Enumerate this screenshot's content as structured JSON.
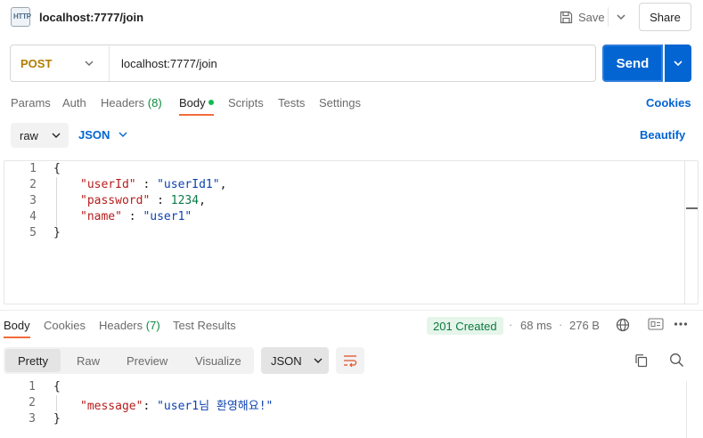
{
  "header": {
    "title": "localhost:7777/join",
    "app_icon_text": "HTTP",
    "save_label": "Save",
    "share_label": "Share"
  },
  "request": {
    "method": "POST",
    "url": "localhost:7777/join",
    "send_label": "Send"
  },
  "request_tabs": [
    {
      "label": "Params"
    },
    {
      "label": "Auth"
    },
    {
      "label": "Headers",
      "count": "(8)"
    },
    {
      "label": "Body",
      "active": true
    },
    {
      "label": "Scripts"
    },
    {
      "label": "Tests"
    },
    {
      "label": "Settings"
    }
  ],
  "cookies_label": "Cookies",
  "body_mode": {
    "mode": "raw",
    "format": "JSON",
    "beautify_label": "Beautify"
  },
  "request_body": {
    "line_numbers": [
      "1",
      "2",
      "3",
      "4",
      "5"
    ],
    "open_brace": "{",
    "close_brace": "}",
    "lines": [
      {
        "key": "\"userId\"",
        "sep": " : ",
        "value": "\"userId1\"",
        "trail": ","
      },
      {
        "key": "\"password\"",
        "sep": " : ",
        "value": "1234",
        "trail": ","
      },
      {
        "key": "\"name\"",
        "sep": " : ",
        "value": "\"user1\"",
        "trail": ""
      }
    ]
  },
  "response_tabs": [
    {
      "label": "Body",
      "active": true
    },
    {
      "label": "Cookies"
    },
    {
      "label": "Headers",
      "count": "(7)"
    },
    {
      "label": "Test Results"
    }
  ],
  "response_meta": {
    "status": "201 Created",
    "separator": "·",
    "time": "68 ms",
    "size": "276 B"
  },
  "response_view": {
    "tabs": [
      "Pretty",
      "Raw",
      "Preview",
      "Visualize"
    ],
    "format": "JSON"
  },
  "response_body": {
    "line_numbers": [
      "1",
      "2",
      "3"
    ],
    "open_brace": "{",
    "close_brace": "}",
    "key": "\"message\"",
    "sep": ": ",
    "value": "\"user1님 환영해요!\""
  },
  "colors": {
    "accent": "#0265d2",
    "method": "#b27d00",
    "active_underline": "#f26b3a",
    "status_ok": "#0c7a3e"
  }
}
